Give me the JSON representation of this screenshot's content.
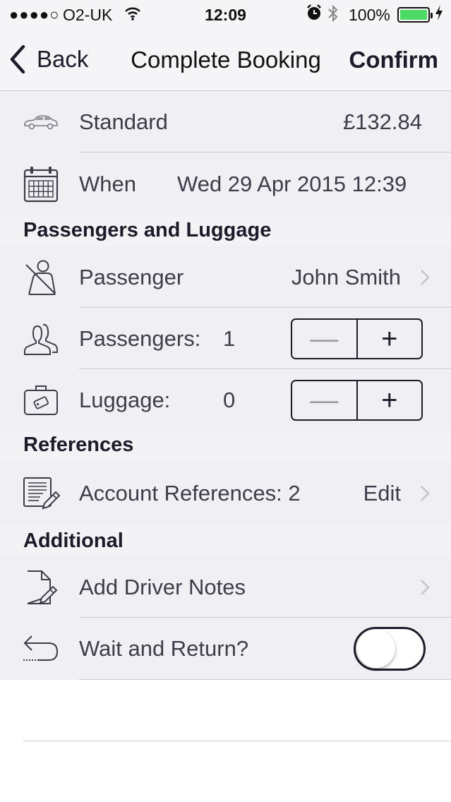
{
  "status_bar": {
    "signal": "●●●●○",
    "carrier": "O2-UK",
    "time": "12:09",
    "battery_pct": "100%",
    "wifi_icon": "wifi-icon",
    "alarm_icon": "alarm-icon",
    "bluetooth_icon": "bluetooth-icon",
    "battery_level": 1.0,
    "battery_color": "#4cd964"
  },
  "nav": {
    "back_label": "Back",
    "title": "Complete Booking",
    "confirm_label": "Confirm"
  },
  "vehicle": {
    "label": "Standard",
    "price": "£132.84",
    "icon": "car-icon"
  },
  "when": {
    "label": "When",
    "value": "Wed 29 Apr 2015 12:39",
    "icon": "calendar-icon"
  },
  "sections": {
    "passengers": "Passengers and Luggage",
    "references": "References",
    "additional": "Additional"
  },
  "passenger": {
    "label": "Passenger",
    "value": "John Smith",
    "icon": "passenger-icon"
  },
  "passenger_count": {
    "label": "Passengers:",
    "value": "1",
    "minus": "—",
    "plus": "+",
    "icon": "people-icon"
  },
  "luggage_count": {
    "label": "Luggage:",
    "value": "0",
    "minus": "—",
    "plus": "+",
    "icon": "luggage-icon"
  },
  "account_refs": {
    "label": "Account References: 2",
    "action": "Edit",
    "icon": "notes-edit-icon"
  },
  "driver_notes": {
    "label": "Add Driver Notes",
    "icon": "document-edit-icon"
  },
  "wait_return": {
    "label": "Wait and Return?",
    "enabled": false,
    "icon": "return-arrow-icon"
  },
  "colors": {
    "text": "#1b1b2a",
    "secondary_text": "#3d3d4a",
    "table_bg": "#efeff4",
    "separator": "#c8c7cc"
  }
}
